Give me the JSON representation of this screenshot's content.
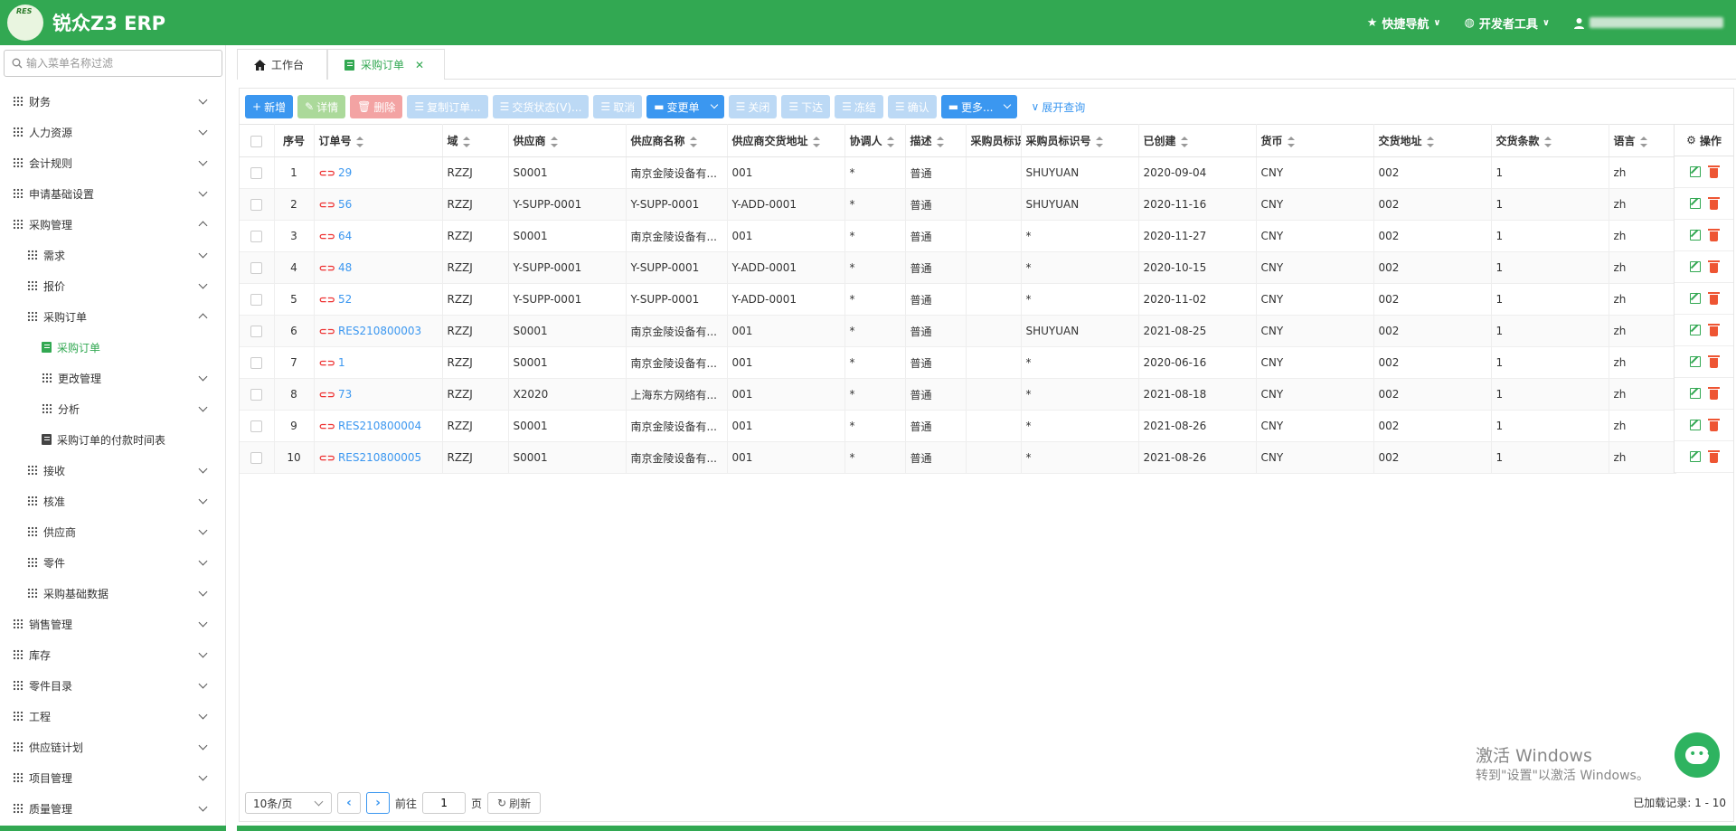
{
  "header": {
    "logo_text": "RES",
    "brand": "锐众Z3 ERP",
    "quick_nav": "快捷导航",
    "dev_tools": "开发者工具"
  },
  "sidebar": {
    "search_placeholder": "输入菜单名称过滤",
    "items": [
      {
        "label": "财务",
        "level": 0,
        "icon": "grid-icon",
        "chevron": "down"
      },
      {
        "label": "人力资源",
        "level": 0,
        "icon": "grid-icon",
        "chevron": "down"
      },
      {
        "label": "会计规则",
        "level": 0,
        "icon": "grid-icon",
        "chevron": "down"
      },
      {
        "label": "申请基础设置",
        "level": 0,
        "icon": "grid-icon",
        "chevron": "down"
      },
      {
        "label": "采购管理",
        "level": 0,
        "icon": "grid-icon",
        "chevron": "up"
      },
      {
        "label": "需求",
        "level": 1,
        "icon": "grid-icon",
        "chevron": "down"
      },
      {
        "label": "报价",
        "level": 1,
        "icon": "grid-icon",
        "chevron": "down"
      },
      {
        "label": "采购订单",
        "level": 1,
        "icon": "grid-icon",
        "chevron": "up"
      },
      {
        "label": "采购订单",
        "level": 2,
        "icon": "doc-icon",
        "chevron": "",
        "active": true
      },
      {
        "label": "更改管理",
        "level": 2,
        "icon": "grid-icon",
        "chevron": "down"
      },
      {
        "label": "分析",
        "level": 2,
        "icon": "grid-icon",
        "chevron": "down"
      },
      {
        "label": "采购订单的付款时间表",
        "level": 2,
        "icon": "doc-dark-icon",
        "chevron": ""
      },
      {
        "label": "接收",
        "level": 1,
        "icon": "grid-icon",
        "chevron": "down"
      },
      {
        "label": "核准",
        "level": 1,
        "icon": "grid-icon",
        "chevron": "down"
      },
      {
        "label": "供应商",
        "level": 1,
        "icon": "grid-icon",
        "chevron": "down"
      },
      {
        "label": "零件",
        "level": 1,
        "icon": "grid-icon",
        "chevron": "down"
      },
      {
        "label": "采购基础数据",
        "level": 1,
        "icon": "grid-icon",
        "chevron": "down"
      },
      {
        "label": "销售管理",
        "level": 0,
        "icon": "grid-icon",
        "chevron": "down"
      },
      {
        "label": "库存",
        "level": 0,
        "icon": "grid-icon",
        "chevron": "down"
      },
      {
        "label": "零件目录",
        "level": 0,
        "icon": "grid-icon",
        "chevron": "down"
      },
      {
        "label": "工程",
        "level": 0,
        "icon": "grid-icon",
        "chevron": "down"
      },
      {
        "label": "供应链计划",
        "level": 0,
        "icon": "grid-icon",
        "chevron": "down"
      },
      {
        "label": "项目管理",
        "level": 0,
        "icon": "grid-icon",
        "chevron": "down"
      },
      {
        "label": "质量管理",
        "level": 0,
        "icon": "grid-icon",
        "chevron": "down"
      }
    ]
  },
  "tabs": {
    "home": "工作台",
    "active": "采购订单"
  },
  "toolbar": {
    "add": "新增",
    "detail": "详情",
    "delete": "删除",
    "copy": "复制订单...",
    "delivery_status": "交货状态(V)...",
    "cancel": "取消",
    "change_order": "变更单",
    "close": "关闭",
    "release": "下达",
    "freeze": "冻结",
    "confirm": "确认",
    "more": "更多...",
    "expand_query": "展开查询"
  },
  "table": {
    "columns": [
      "序号",
      "订单号",
      "域",
      "供应商",
      "供应商名称",
      "供应商交货地址",
      "协调人",
      "描述",
      "采购员标识",
      "采购员标识号",
      "已创建",
      "货币",
      "交货地址",
      "交货条款",
      "语言"
    ],
    "ops_header": "操作",
    "rows": [
      [
        "1",
        "29",
        "RZZJ",
        "S0001",
        "南京金陵设备有...",
        "001",
        "*",
        "普通",
        "",
        "SHUYUAN",
        "2020-09-04",
        "CNY",
        "002",
        "1",
        "zh"
      ],
      [
        "2",
        "56",
        "RZZJ",
        "Y-SUPP-0001",
        "Y-SUPP-0001",
        "Y-ADD-0001",
        "*",
        "普通",
        "",
        "SHUYUAN",
        "2020-11-16",
        "CNY",
        "002",
        "1",
        "zh"
      ],
      [
        "3",
        "64",
        "RZZJ",
        "S0001",
        "南京金陵设备有...",
        "001",
        "*",
        "普通",
        "",
        "*",
        "2020-11-27",
        "CNY",
        "002",
        "1",
        "zh"
      ],
      [
        "4",
        "48",
        "RZZJ",
        "Y-SUPP-0001",
        "Y-SUPP-0001",
        "Y-ADD-0001",
        "*",
        "普通",
        "",
        "*",
        "2020-10-15",
        "CNY",
        "002",
        "1",
        "zh"
      ],
      [
        "5",
        "52",
        "RZZJ",
        "Y-SUPP-0001",
        "Y-SUPP-0001",
        "Y-ADD-0001",
        "*",
        "普通",
        "",
        "*",
        "2020-11-02",
        "CNY",
        "002",
        "1",
        "zh"
      ],
      [
        "6",
        "RES210800003",
        "RZZJ",
        "S0001",
        "南京金陵设备有...",
        "001",
        "*",
        "普通",
        "",
        "SHUYUAN",
        "2021-08-25",
        "CNY",
        "002",
        "1",
        "zh"
      ],
      [
        "7",
        "1",
        "RZZJ",
        "S0001",
        "南京金陵设备有...",
        "001",
        "*",
        "普通",
        "",
        "*",
        "2020-06-16",
        "CNY",
        "002",
        "1",
        "zh"
      ],
      [
        "8",
        "73",
        "RZZJ",
        "X2020",
        "上海东方网络有...",
        "001",
        "*",
        "普通",
        "",
        "*",
        "2021-08-18",
        "CNY",
        "002",
        "1",
        "zh"
      ],
      [
        "9",
        "RES210800004",
        "RZZJ",
        "S0001",
        "南京金陵设备有...",
        "001",
        "*",
        "普通",
        "",
        "*",
        "2021-08-26",
        "CNY",
        "002",
        "1",
        "zh"
      ],
      [
        "10",
        "RES210800005",
        "RZZJ",
        "S0001",
        "南京金陵设备有...",
        "001",
        "*",
        "普通",
        "",
        "*",
        "2021-08-26",
        "CNY",
        "002",
        "1",
        "zh"
      ]
    ]
  },
  "pager": {
    "page_size": "10条/页",
    "goto": "前往",
    "page_value": "1",
    "page_unit": "页",
    "refresh": "刷新",
    "records": "已加载记录: 1 - 10"
  },
  "watermark": {
    "line1": "激活 Windows",
    "line2": "转到\"设置\"以激活 Windows。"
  },
  "colors": {
    "brand_green": "#32a852",
    "primary_blue": "#3b97f0",
    "danger_red": "#e53333"
  }
}
